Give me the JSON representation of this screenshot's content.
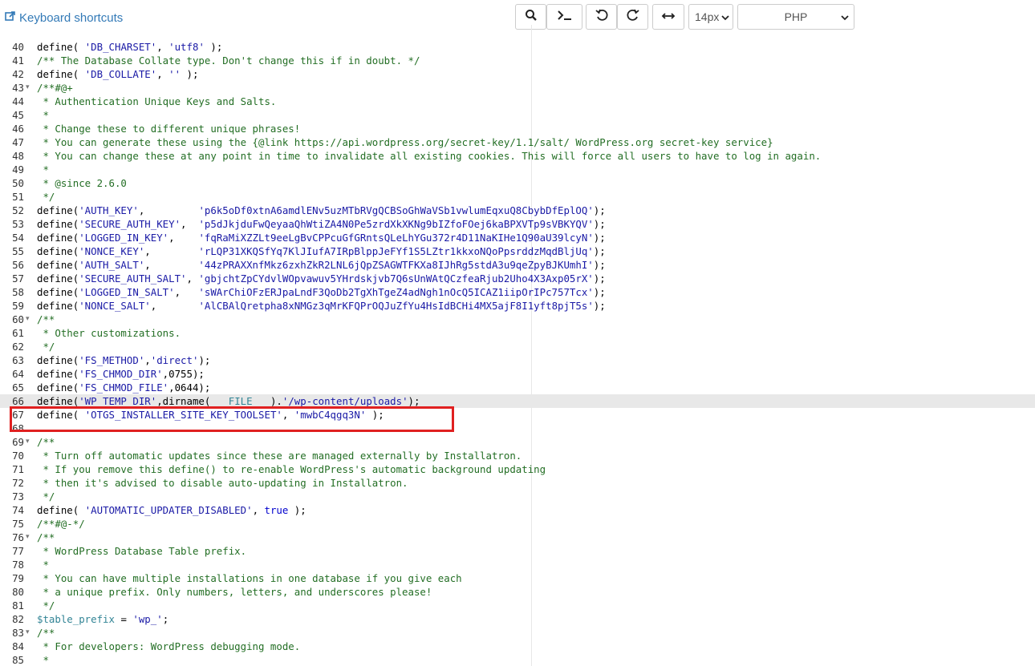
{
  "toolbar": {
    "keyboard_shortcuts_label": "Keyboard shortcuts",
    "buttons": [
      {
        "name": "search-button",
        "icon": "search-icon"
      },
      {
        "name": "terminal-button",
        "icon": "terminal-icon"
      },
      {
        "name": "undo-button",
        "icon": "undo-icon"
      },
      {
        "name": "redo-button",
        "icon": "redo-icon"
      },
      {
        "name": "wrap-toggle-button",
        "icon": "horizontal-arrows-icon"
      }
    ],
    "font_size": "14px",
    "mode": "PHP"
  },
  "colors": {
    "comment": "#236e24",
    "string": "#1a1aa6",
    "keyword": "#0000cd",
    "variable": "#318495",
    "highlight_box": "#e02020",
    "link": "#337ab7"
  },
  "editor": {
    "active_line_number": 66,
    "highlighted_lines": [
      67,
      68
    ],
    "lines": [
      {
        "n": 40,
        "tokens": [
          [
            "plain",
            "define( "
          ],
          [
            "string",
            "'DB_CHARSET'"
          ],
          [
            "plain",
            ", "
          ],
          [
            "string",
            "'utf8'"
          ],
          [
            "plain",
            " );"
          ]
        ]
      },
      {
        "n": 41,
        "tokens": [
          [
            "comment",
            "/** The Database Collate type. Don't change this if in doubt. */"
          ]
        ]
      },
      {
        "n": 42,
        "tokens": [
          [
            "plain",
            "define( "
          ],
          [
            "string",
            "'DB_COLLATE'"
          ],
          [
            "plain",
            ", "
          ],
          [
            "string",
            "''"
          ],
          [
            "plain",
            " );"
          ]
        ]
      },
      {
        "n": 43,
        "fold": true,
        "tokens": [
          [
            "comment",
            "/**#@+"
          ]
        ]
      },
      {
        "n": 44,
        "tokens": [
          [
            "comment",
            " * Authentication Unique Keys and Salts."
          ]
        ]
      },
      {
        "n": 45,
        "tokens": [
          [
            "comment",
            " *"
          ]
        ]
      },
      {
        "n": 46,
        "tokens": [
          [
            "comment",
            " * Change these to different unique phrases!"
          ]
        ]
      },
      {
        "n": 47,
        "tokens": [
          [
            "comment",
            " * You can generate these using the {@link https://api.wordpress.org/secret-key/1.1/salt/ WordPress.org secret-key service}"
          ]
        ]
      },
      {
        "n": 48,
        "tokens": [
          [
            "comment",
            " * You can change these at any point in time to invalidate all existing cookies. This will force all users to have to log in again."
          ]
        ]
      },
      {
        "n": 49,
        "tokens": [
          [
            "comment",
            " *"
          ]
        ]
      },
      {
        "n": 50,
        "tokens": [
          [
            "comment",
            " * @since 2.6.0"
          ]
        ]
      },
      {
        "n": 51,
        "tokens": [
          [
            "comment",
            " */"
          ]
        ]
      },
      {
        "n": 52,
        "tokens": [
          [
            "plain",
            "define("
          ],
          [
            "string",
            "'AUTH_KEY'"
          ],
          [
            "plain",
            ",         "
          ],
          [
            "string",
            "'p6k5oDf0xtnA6amdlENv5uzMTbRVgQCBSoGhWaVSb1vwlumEqxuQ8CbybDfEplOQ'"
          ],
          [
            "plain",
            ");"
          ]
        ]
      },
      {
        "n": 53,
        "tokens": [
          [
            "plain",
            "define("
          ],
          [
            "string",
            "'SECURE_AUTH_KEY'"
          ],
          [
            "plain",
            ",  "
          ],
          [
            "string",
            "'p5dJkjduFwQeyaaQhWtiZA4N0Pe5zrdXkXKNg9bIZfoFOej6kaBPXVTp9sVBKYQV'"
          ],
          [
            "plain",
            ");"
          ]
        ]
      },
      {
        "n": 54,
        "tokens": [
          [
            "plain",
            "define("
          ],
          [
            "string",
            "'LOGGED_IN_KEY'"
          ],
          [
            "plain",
            ",    "
          ],
          [
            "string",
            "'fqRaMiXZZLt9eeLgBvCPPcuGfGRntsQLeLhYGu372r4D11NaKIHe1Q90aU39lcyN'"
          ],
          [
            "plain",
            ");"
          ]
        ]
      },
      {
        "n": 55,
        "tokens": [
          [
            "plain",
            "define("
          ],
          [
            "string",
            "'NONCE_KEY'"
          ],
          [
            "plain",
            ",        "
          ],
          [
            "string",
            "'rLQP31XKQSfYq7KlJIufA7IRpBlppJeFYf1S5LZtr1kkxoNQoPpsrddzMqdBljUq'"
          ],
          [
            "plain",
            ");"
          ]
        ]
      },
      {
        "n": 56,
        "tokens": [
          [
            "plain",
            "define("
          ],
          [
            "string",
            "'AUTH_SALT'"
          ],
          [
            "plain",
            ",        "
          ],
          [
            "string",
            "'44zPRAXXnfMkz6zxhZkR2LNL6jQpZSAGWTFKXa8IJhRg5stdA3u9qeZpyBJKUmhI'"
          ],
          [
            "plain",
            ");"
          ]
        ]
      },
      {
        "n": 57,
        "tokens": [
          [
            "plain",
            "define("
          ],
          [
            "string",
            "'SECURE_AUTH_SALT'"
          ],
          [
            "plain",
            ", "
          ],
          [
            "string",
            "'gbjchtZpCYdvlWOpvawuv5YHrdskjvb7Q6sUnWAtQCzfeaRjub2Uho4X3Axp05rX'"
          ],
          [
            "plain",
            ");"
          ]
        ]
      },
      {
        "n": 58,
        "tokens": [
          [
            "plain",
            "define("
          ],
          [
            "string",
            "'LOGGED_IN_SALT'"
          ],
          [
            "plain",
            ",   "
          ],
          [
            "string",
            "'sWArChiOFzERJpaLndF3QoDb2TgXhTgeZ4adNgh1nOcQ5ICAZ1iipOrIPc757Tcx'"
          ],
          [
            "plain",
            ");"
          ]
        ]
      },
      {
        "n": 59,
        "tokens": [
          [
            "plain",
            "define("
          ],
          [
            "string",
            "'NONCE_SALT'"
          ],
          [
            "plain",
            ",       "
          ],
          [
            "string",
            "'AlCBAlQretpha8xNMGz3qMrKFQPrOQJuZfYu4HsIdBCHi4MX5ajF8I1yft8pjT5s'"
          ],
          [
            "plain",
            ");"
          ]
        ]
      },
      {
        "n": 60,
        "fold": true,
        "tokens": [
          [
            "comment",
            "/**"
          ]
        ]
      },
      {
        "n": 61,
        "tokens": [
          [
            "comment",
            " * Other customizations."
          ]
        ]
      },
      {
        "n": 62,
        "tokens": [
          [
            "comment",
            " */"
          ]
        ]
      },
      {
        "n": 63,
        "tokens": [
          [
            "plain",
            "define("
          ],
          [
            "string",
            "'FS_METHOD'"
          ],
          [
            "plain",
            ","
          ],
          [
            "string",
            "'direct'"
          ],
          [
            "plain",
            ");"
          ]
        ]
      },
      {
        "n": 64,
        "tokens": [
          [
            "plain",
            "define("
          ],
          [
            "string",
            "'FS_CHMOD_DIR'"
          ],
          [
            "plain",
            ",0755);"
          ]
        ]
      },
      {
        "n": 65,
        "tokens": [
          [
            "plain",
            "define("
          ],
          [
            "string",
            "'FS_CHMOD_FILE'"
          ],
          [
            "plain",
            ",0644);"
          ]
        ]
      },
      {
        "n": 66,
        "tokens": [
          [
            "plain",
            "define("
          ],
          [
            "string",
            "'WP_TEMP_DIR'"
          ],
          [
            "plain",
            ",dirname( "
          ],
          [
            "magic",
            "__FILE__"
          ],
          [
            "plain",
            " )."
          ],
          [
            "string",
            "'/wp-content/uploads'"
          ],
          [
            "plain",
            ");"
          ]
        ]
      },
      {
        "n": 67,
        "tokens": [
          [
            "plain",
            "define( "
          ],
          [
            "string",
            "'OTGS_INSTALLER_SITE_KEY_TOOLSET'"
          ],
          [
            "plain",
            ", "
          ],
          [
            "string",
            "'mwbC4qgq3N'"
          ],
          [
            "plain",
            " );"
          ]
        ]
      },
      {
        "n": 68,
        "tokens": [
          [
            "plain",
            ""
          ]
        ]
      },
      {
        "n": 69,
        "fold": true,
        "tokens": [
          [
            "comment",
            "/**"
          ]
        ]
      },
      {
        "n": 70,
        "tokens": [
          [
            "comment",
            " * Turn off automatic updates since these are managed externally by Installatron."
          ]
        ]
      },
      {
        "n": 71,
        "tokens": [
          [
            "comment",
            " * If you remove this define() to re-enable WordPress's automatic background updating"
          ]
        ]
      },
      {
        "n": 72,
        "tokens": [
          [
            "comment",
            " * then it's advised to disable auto-updating in Installatron."
          ]
        ]
      },
      {
        "n": 73,
        "tokens": [
          [
            "comment",
            " */"
          ]
        ]
      },
      {
        "n": 74,
        "tokens": [
          [
            "plain",
            "define( "
          ],
          [
            "string",
            "'AUTOMATIC_UPDATER_DISABLED'"
          ],
          [
            "plain",
            ", "
          ],
          [
            "bool",
            "true"
          ],
          [
            "plain",
            " );"
          ]
        ]
      },
      {
        "n": 75,
        "tokens": [
          [
            "comment",
            "/**#@-*/"
          ]
        ]
      },
      {
        "n": 76,
        "fold": true,
        "tokens": [
          [
            "comment",
            "/**"
          ]
        ]
      },
      {
        "n": 77,
        "tokens": [
          [
            "comment",
            " * WordPress Database Table prefix."
          ]
        ]
      },
      {
        "n": 78,
        "tokens": [
          [
            "comment",
            " *"
          ]
        ]
      },
      {
        "n": 79,
        "tokens": [
          [
            "comment",
            " * You can have multiple installations in one database if you give each"
          ]
        ]
      },
      {
        "n": 80,
        "tokens": [
          [
            "comment",
            " * a unique prefix. Only numbers, letters, and underscores please!"
          ]
        ]
      },
      {
        "n": 81,
        "tokens": [
          [
            "comment",
            " */"
          ]
        ]
      },
      {
        "n": 82,
        "tokens": [
          [
            "var",
            "$table_prefix"
          ],
          [
            "plain",
            " = "
          ],
          [
            "string",
            "'wp_'"
          ],
          [
            "plain",
            ";"
          ]
        ]
      },
      {
        "n": 83,
        "fold": true,
        "tokens": [
          [
            "comment",
            "/**"
          ]
        ]
      },
      {
        "n": 84,
        "tokens": [
          [
            "comment",
            " * For developers: WordPress debugging mode."
          ]
        ]
      },
      {
        "n": 85,
        "tokens": [
          [
            "comment",
            " *"
          ]
        ]
      }
    ]
  }
}
